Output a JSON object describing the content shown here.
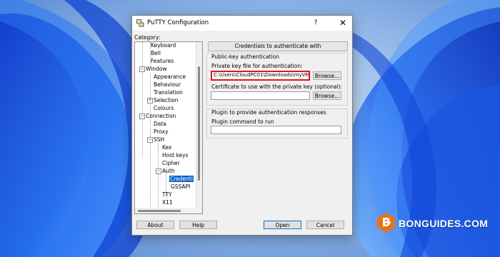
{
  "window": {
    "title": "PuTTY Configuration",
    "help_glyph": "?",
    "close_glyph": "✕"
  },
  "category_label": "Category:",
  "tree": [
    {
      "label": "Keyboard"
    },
    {
      "label": "Bell"
    },
    {
      "label": "Features"
    },
    {
      "label": "Window",
      "expander": "−"
    },
    {
      "label": "Appearance"
    },
    {
      "label": "Behaviour"
    },
    {
      "label": "Translation"
    },
    {
      "label": "Selection",
      "expander": "+"
    },
    {
      "label": "Colours"
    },
    {
      "label": "Connection",
      "expander": "−"
    },
    {
      "label": "Data"
    },
    {
      "label": "Proxy"
    },
    {
      "label": "SSH",
      "expander": "−"
    },
    {
      "label": "Kex"
    },
    {
      "label": "Host keys"
    },
    {
      "label": "Cipher"
    },
    {
      "label": "Auth",
      "expander": "−"
    },
    {
      "label": "Credenti",
      "selected": true
    },
    {
      "label": "GSSAPI"
    },
    {
      "label": "TTY"
    },
    {
      "label": "X11"
    }
  ],
  "panel": {
    "header": "Credentials to authenticate with",
    "pubkey_group": {
      "title": "Public-key authentication",
      "private_key_label": "Private key file for authentication:",
      "private_key_value": "C:\\Users\\CloudPC01\\Downloads\\myVM",
      "browse_label": "Browse...",
      "certificate_label": "Certificate to use with the private key (optional):",
      "certificate_value": "",
      "browse2_label": "Browse..."
    },
    "plugin_group": {
      "title": "Plugin to provide authentication responses",
      "command_label": "Plugin command to run",
      "command_value": ""
    }
  },
  "buttons": {
    "about": "About",
    "help": "Help",
    "open": "Open",
    "cancel": "Cancel"
  },
  "watermark": {
    "text": "BONGUIDES.COM",
    "accent": "#e8731c"
  }
}
